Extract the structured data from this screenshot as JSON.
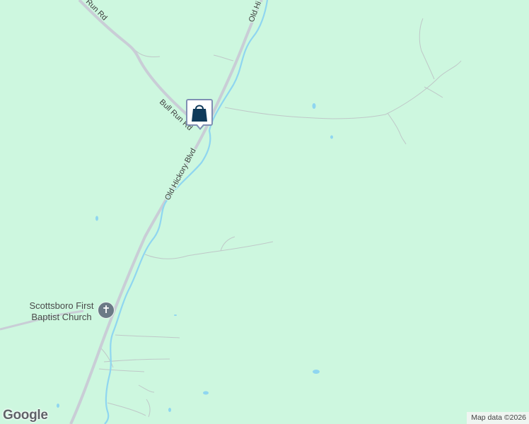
{
  "map": {
    "background_color": "#cdf7df",
    "water_color": "#8fd6f0",
    "road_color": "#c9cdd6",
    "roads": [
      {
        "name": "Bull Run Rd"
      },
      {
        "name": "Old Hickory Blvd"
      },
      {
        "name": "Old Hi"
      }
    ],
    "road_labels": {
      "bull_run_top": "Run Rd",
      "bull_run_mid": "Bull Run Rd",
      "old_hickory": "Old Hickory Blvd",
      "old_hickory_top": "Old Hi"
    },
    "poi": {
      "name": "Scottsboro First Baptist Church",
      "name_line1": "Scottsboro First",
      "name_line2": "Baptist Church",
      "icon": "church-cross-icon",
      "icon_glyph": "✝"
    },
    "marker": {
      "icon": "shopping-bag-icon",
      "border_color": "#7f8fb3",
      "icon_color": "#0f3a5a"
    }
  },
  "branding": {
    "logo_text": "Google"
  },
  "attribution": {
    "text": "Map data ©2026"
  }
}
